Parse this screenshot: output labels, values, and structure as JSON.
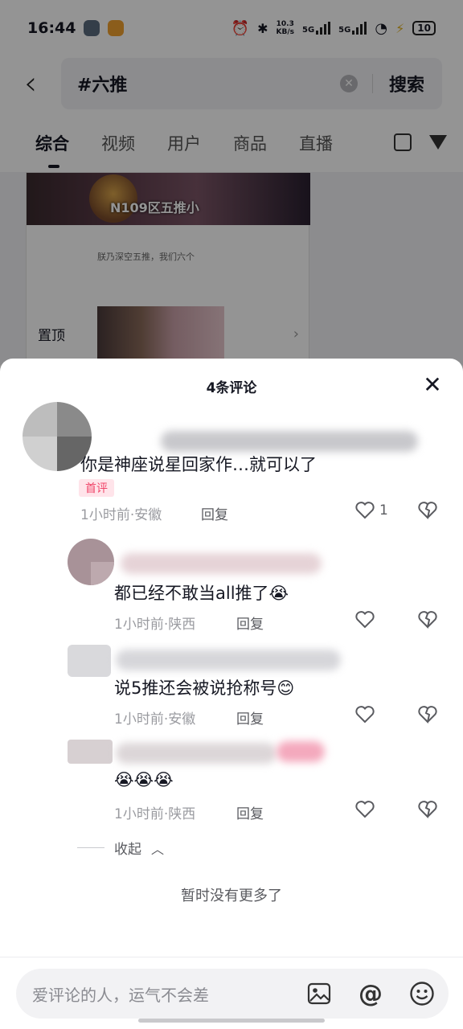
{
  "status_bar": {
    "time": "16:44",
    "net_speed_value": "10.3",
    "net_speed_unit": "KB/s",
    "sig1": "5G",
    "sig2": "5G",
    "battery": "10"
  },
  "search": {
    "query": "#六推",
    "search_label": "搜索"
  },
  "tabs": [
    {
      "label": "综合",
      "active": true
    },
    {
      "label": "视频",
      "active": false
    },
    {
      "label": "用户",
      "active": false
    },
    {
      "label": "商品",
      "active": false
    },
    {
      "label": "直播",
      "active": false
    }
  ],
  "feed": {
    "banner_title": "N109区五推小",
    "description": "朕乃深空五推，我们六个",
    "pin_label": "置顶"
  },
  "comments_sheet": {
    "title": "4条评论",
    "collapse_label": "收起",
    "no_more_label": "暂时没有更多了",
    "comments": [
      {
        "text": "你是神座说星回家作…就可以了",
        "badge": "首评",
        "meta": "1小时前·安徽",
        "reply_label": "回复",
        "likes": "1"
      },
      {
        "text": "都已经不敢当all推了😭",
        "meta": "1小时前·陕西",
        "reply_label": "回复",
        "likes": ""
      },
      {
        "text": "说5推还会被说抢称号😊",
        "meta": "1小时前·安徽",
        "reply_label": "回复",
        "likes": ""
      },
      {
        "text": "😭😭😭",
        "meta": "1小时前·陕西",
        "reply_label": "回复",
        "likes": ""
      }
    ]
  },
  "input": {
    "placeholder": "爱评论的人，运气不会差",
    "image_icon": "image-icon",
    "mention_icon": "at-icon",
    "emoji_icon": "emoji-icon"
  },
  "colors": {
    "badge_text": "#f0466a",
    "badge_bg": "#ffe4ea",
    "dim_overlay": "rgba(0,0,0,0.42)"
  }
}
